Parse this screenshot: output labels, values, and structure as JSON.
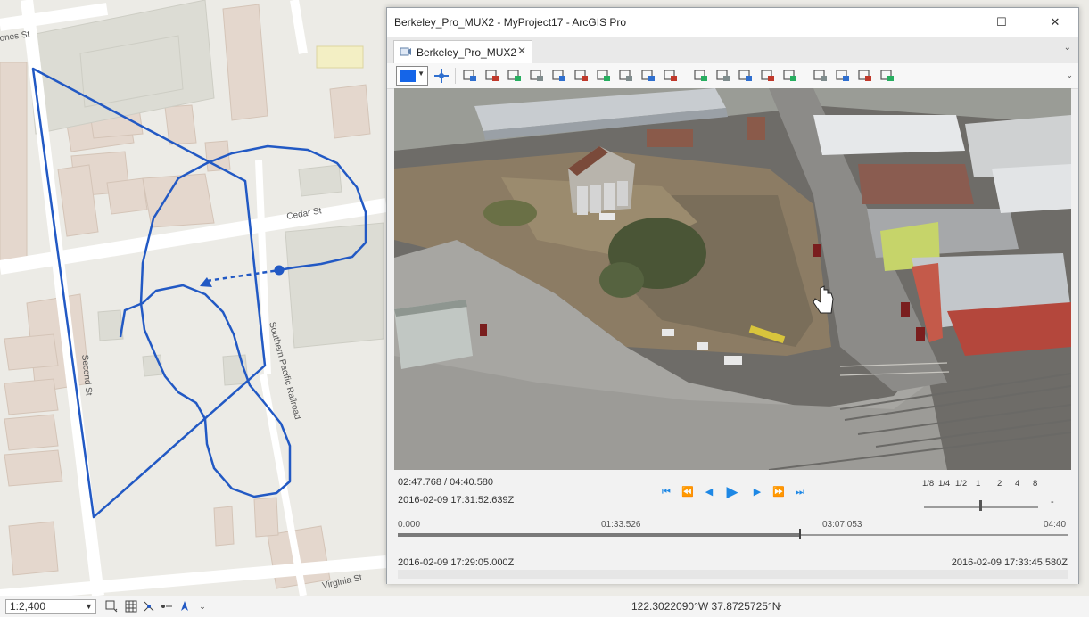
{
  "map": {
    "streets": {
      "jones": "ones St",
      "cedar": "Cedar St",
      "second": "Second St",
      "southern_pacific": "Southern Pacific Railroad",
      "virginia": "Virginia St"
    },
    "track_color": "#2259c4"
  },
  "status_bar": {
    "scale": "1:2,400",
    "coordinates": "122.3022090°W 37.8725725°N"
  },
  "window": {
    "title": "Berkeley_Pro_MUX2 - MyProject17 - ArcGIS Pro",
    "tab_label": "Berkeley_Pro_MUX2",
    "toolbar_color": "#1565e8",
    "toolbar_icons": [
      "pan-icon",
      "zoom-to-video-icon",
      "marker-icon",
      "add-frame-icon",
      "measure-icon",
      "sensor-icon",
      "footprint-icon",
      "frame-center-icon",
      "north-icon",
      "camera-icon",
      "export-frames-icon",
      "snapshot-icon",
      "bookmark-icon",
      "bookmark-edit-icon",
      "video-metadata-icon",
      "overlay-icon",
      "chart-icon",
      "layer-icon",
      "record-icon",
      "export-icon"
    ]
  },
  "player": {
    "position": "02:47.768 / 04:40.580",
    "current_datetime": "2016-02-09 17:31:52.639Z",
    "rates": [
      "1/8",
      "1/4",
      "1/2",
      "1",
      "2",
      "4",
      "8"
    ],
    "rate_minus": "-",
    "timeline_ticks": [
      "0.000",
      "01:33.526",
      "03:07.053",
      "04:40"
    ],
    "progress_fraction": 0.598,
    "start_datetime": "2016-02-09 17:29:05.000Z",
    "end_datetime": "2016-02-09 17:33:45.580Z"
  }
}
